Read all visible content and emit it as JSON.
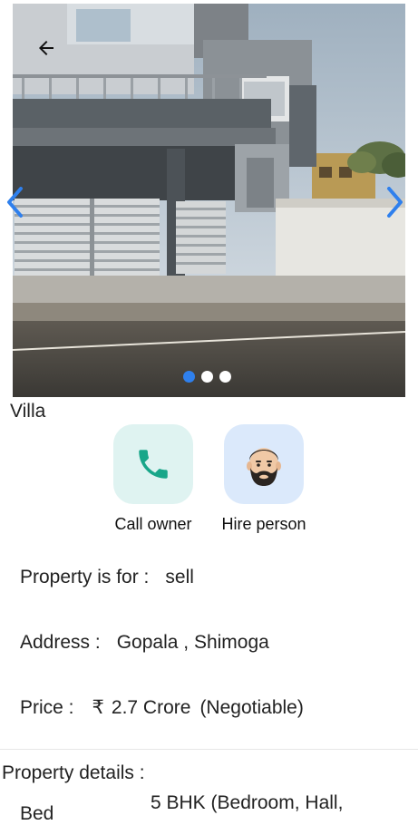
{
  "hero": {
    "slide_count": 3,
    "active_slide": 1
  },
  "property_type": "Villa",
  "actions": {
    "call_label": "Call owner",
    "hire_label": "Hire person"
  },
  "info": {
    "purpose_label": "Property is for :",
    "purpose_value": "sell",
    "address_label": "Address :",
    "address_value": "Gopala ,  Shimoga",
    "price_label": "Price :",
    "price_currency": "₹",
    "price_value": "2.7 Crore",
    "price_note": "(Negotiable)"
  },
  "details": {
    "title": "Property details :",
    "first_key": "Bed",
    "first_value": "5 BHK (Bedroom, Hall,"
  },
  "icons": {
    "back": "arrow-back-icon",
    "prev": "chevron-left-icon",
    "next": "chevron-right-icon",
    "call": "phone-icon",
    "hire": "person-avatar-icon"
  },
  "colors": {
    "accent_blue": "#2f80ed",
    "call_tile": "#dff3f1",
    "call_icon": "#18a689",
    "hire_tile": "#dbe9fb"
  }
}
